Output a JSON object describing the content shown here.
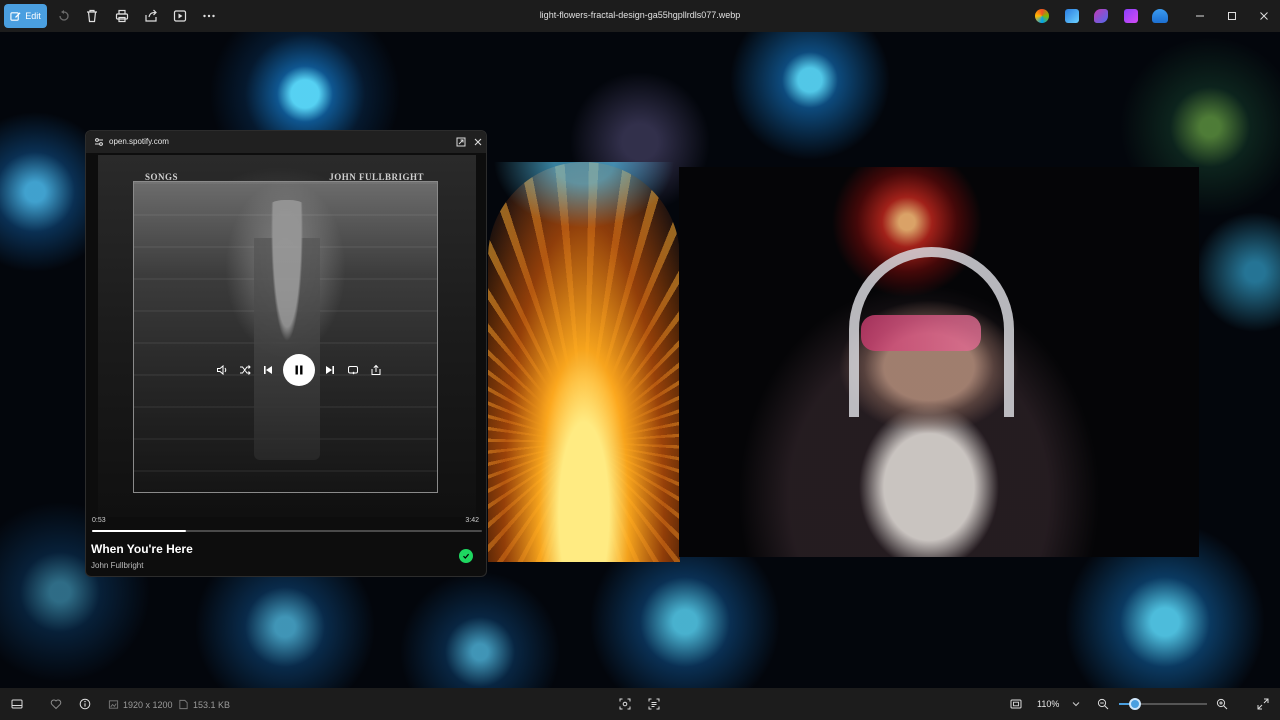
{
  "toolbar": {
    "edit_label": "Edit",
    "filename": "light-flowers-fractal-design-ga55hgpllrdls077.webp",
    "icons": [
      "edit-icon",
      "rotate-icon",
      "delete-icon",
      "print-icon",
      "share-icon",
      "slideshow-icon",
      "more-icon"
    ],
    "app_icons": [
      "copilot-icon",
      "designer-icon",
      "clipchamp-icon",
      "clipchamp-video-icon",
      "onedrive-icon"
    ],
    "window_buttons": [
      "minimize",
      "maximize",
      "close"
    ]
  },
  "popup": {
    "url": "open.spotify.com",
    "album_left_text": "SONGS",
    "album_right_text": "JOHN FULLBRIGHT",
    "time_current": "0:53",
    "time_total": "3:42",
    "progress": 0.24,
    "track_title": "When You're Here",
    "track_artist": "John Fullbright",
    "controls": [
      "volume",
      "shuffle",
      "previous",
      "pause",
      "next",
      "repeat",
      "share"
    ],
    "accent_color": "#1ed760"
  },
  "statusbar": {
    "dimensions": "1920 x 1200",
    "file_size": "153.1 KB",
    "zoom": "110%",
    "zoom_level": 0.18
  },
  "colors": {
    "accent": "#4a9fe0",
    "chrome_bg": "#1c1c1c"
  }
}
